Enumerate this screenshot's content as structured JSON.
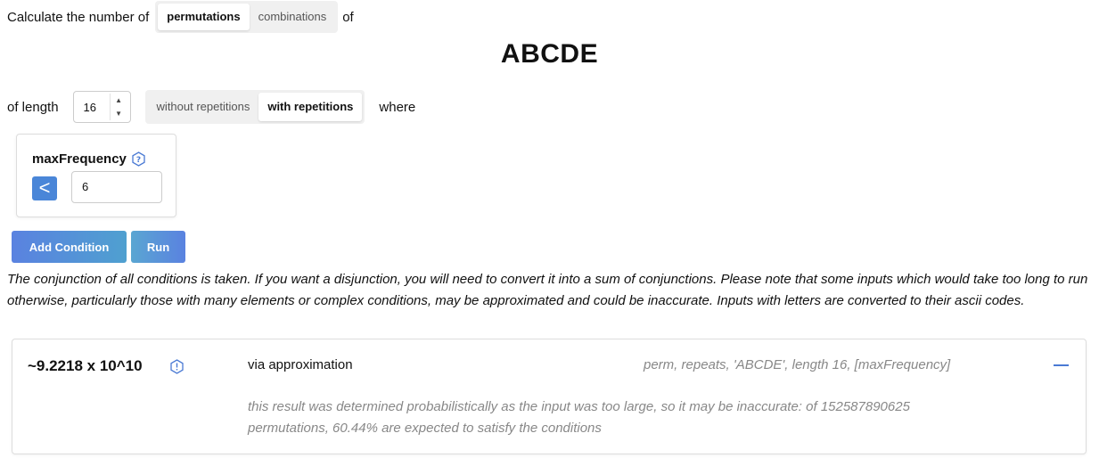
{
  "header": {
    "prefix": "Calculate the number of",
    "modes": [
      "permutations",
      "combinations"
    ],
    "active_mode": "permutations",
    "suffix": "of"
  },
  "input_string": "ABCDE",
  "length_row": {
    "label": "of length",
    "length_value": "16",
    "repetition_options": [
      "without repetitions",
      "with repetitions"
    ],
    "active_repetition": "with repetitions",
    "suffix": "where"
  },
  "condition": {
    "name": "maxFrequency",
    "operator": "<",
    "value": "6"
  },
  "buttons": {
    "add_condition": "Add Condition",
    "run": "Run"
  },
  "note": "The conjunction of all conditions is taken. If you want a disjunction, you will need to convert it into a sum of conjunctions. Please note that some inputs which would take too long to run otherwise, particularly those with many elements or complex conditions, may be approximated and could be inaccurate. Inputs with letters are converted to their ascii codes.",
  "result": {
    "value": "~9.2218 x 10^10",
    "method": "via approximation",
    "description": "perm, repeats, 'ABCDE', length 16, [maxFrequency]",
    "detail": "this result was determined probabilistically as the input was too large, so it may be inaccurate: of 152587890625 permutations, 60.44% are expected to satisfy the conditions"
  },
  "colors": {
    "accent": "#4a86d8",
    "muted_text": "#888888"
  }
}
